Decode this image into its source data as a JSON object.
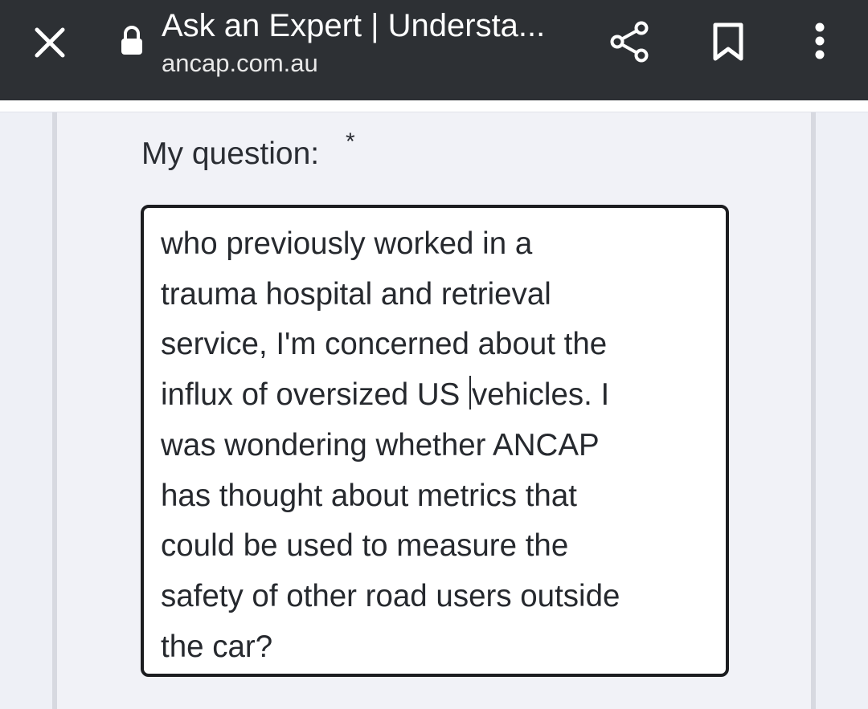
{
  "browser": {
    "title": "Ask an Expert | Understa...",
    "url": "ancap.com.au",
    "icons": [
      "close-icon",
      "lock-icon",
      "share-icon",
      "bookmark-icon",
      "more-icon"
    ],
    "bar_color": "#2d3034"
  },
  "form": {
    "label": "My question:",
    "required_marker": "*",
    "question_lines": [
      "who previously worked in a",
      "trauma hospital and retrieval",
      "service, I'm concerned about the",
      "influx of oversized US ",
      "vehicles. I",
      "was wondering whether ANCAP",
      "has thought about metrics that",
      "could be used to measure the",
      "safety of other road users outside",
      "the car?"
    ]
  },
  "colors": {
    "page_background": "#eef0f6",
    "text": "#26292e"
  }
}
